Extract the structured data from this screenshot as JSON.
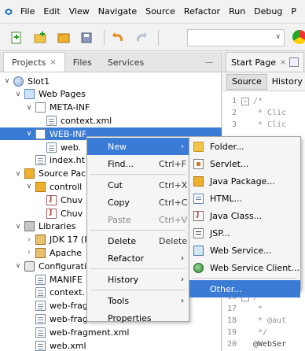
{
  "menubar": {
    "items": [
      "File",
      "Edit",
      "View",
      "Navigate",
      "Source",
      "Refactor",
      "Run",
      "Debug",
      "P"
    ]
  },
  "toolbar": {
    "icons": [
      "new-file-icon",
      "new-project-icon",
      "open-project-icon",
      "save-all-icon",
      "undo-icon",
      "redo-icon"
    ],
    "combo_value": ""
  },
  "projects_panel": {
    "tabs": [
      {
        "label": "Projects",
        "close": "×",
        "active": true
      },
      {
        "label": "Files",
        "active": false
      },
      {
        "label": "Services",
        "active": false
      }
    ],
    "minimize": "—",
    "tree": [
      {
        "label": "Slot1",
        "icon": "globe",
        "indent": 0,
        "chevron": "∨"
      },
      {
        "label": "Web Pages",
        "icon": "webfolder",
        "indent": 1,
        "chevron": "∨"
      },
      {
        "label": "META-INF",
        "icon": "folder-open",
        "indent": 2,
        "chevron": "∨"
      },
      {
        "label": "context.xml",
        "icon": "file",
        "indent": 3,
        "chevron": ""
      },
      {
        "label": "WEB-INF",
        "icon": "folder-open",
        "indent": 2,
        "chevron": "∨",
        "selected": true
      },
      {
        "label": "web.",
        "icon": "file",
        "indent": 3,
        "chevron": ""
      },
      {
        "label": "index.ht",
        "icon": "file",
        "indent": 2,
        "chevron": ""
      },
      {
        "label": "Source Pack",
        "icon": "pkg",
        "indent": 1,
        "chevron": "∨"
      },
      {
        "label": "controll",
        "icon": "pkg",
        "indent": 2,
        "chevron": "∨"
      },
      {
        "label": "Chuv",
        "icon": "java",
        "indent": 3,
        "chevron": ""
      },
      {
        "label": "Chuv",
        "icon": "java",
        "indent": 3,
        "chevron": ""
      },
      {
        "label": "Libraries",
        "icon": "lib",
        "indent": 1,
        "chevron": "∨"
      },
      {
        "label": "JDK 17 (I",
        "icon": "jar",
        "indent": 2,
        "chevron": "›"
      },
      {
        "label": "Apache",
        "icon": "jar",
        "indent": 2,
        "chevron": "›"
      },
      {
        "label": "Configurati",
        "icon": "config",
        "indent": 1,
        "chevron": "∨"
      },
      {
        "label": "MANIFE",
        "icon": "file",
        "indent": 2,
        "chevron": ""
      },
      {
        "label": "context.",
        "icon": "file",
        "indent": 2,
        "chevron": ""
      },
      {
        "label": "web-frag",
        "icon": "file",
        "indent": 2,
        "chevron": ""
      },
      {
        "label": "web-frag",
        "icon": "file",
        "indent": 2,
        "chevron": ""
      },
      {
        "label": "web-fragment.xml",
        "icon": "file",
        "indent": 2,
        "chevron": ""
      },
      {
        "label": "web.xml",
        "icon": "file",
        "indent": 2,
        "chevron": ""
      }
    ]
  },
  "editor": {
    "tab_label": "Start Page",
    "tab_close": "×",
    "subtabs": [
      "Source",
      "History"
    ],
    "top_lines": [
      {
        "n": "1",
        "fold": "−",
        "text": "/*"
      },
      {
        "n": "2",
        "fold": "",
        "text": " * Clic"
      },
      {
        "n": "3",
        "fold": "",
        "text": " * Clic"
      }
    ],
    "bottom_lines": [
      {
        "n": "16",
        "fold": "−",
        "text": "/**"
      },
      {
        "n": "17",
        "fold": "",
        "text": " *"
      },
      {
        "n": "18",
        "fold": "",
        "text": " * @aut"
      },
      {
        "n": "19",
        "fold": "",
        "text": " */"
      },
      {
        "n": "20",
        "fold": "",
        "text": "@WebSer"
      }
    ]
  },
  "context_menu": {
    "items": [
      {
        "label": "New",
        "arrow": "›",
        "highlighted": true
      },
      {
        "label": "Find...",
        "key": "Ctrl+F"
      },
      {
        "sep": true
      },
      {
        "label": "Cut",
        "key": "Ctrl+X"
      },
      {
        "label": "Copy",
        "key": "Ctrl+C"
      },
      {
        "label": "Paste",
        "key": "Ctrl+V",
        "disabled": true
      },
      {
        "sep": true
      },
      {
        "label": "Delete",
        "key": "Delete"
      },
      {
        "label": "Refactor",
        "arrow": "›"
      },
      {
        "sep": true
      },
      {
        "label": "History",
        "arrow": "›"
      },
      {
        "sep": true
      },
      {
        "label": "Tools",
        "arrow": "›"
      },
      {
        "label": "Properties"
      }
    ]
  },
  "new_submenu": {
    "items": [
      {
        "label": "Folder...",
        "icon": "folder"
      },
      {
        "label": "Servlet...",
        "icon": "servlet"
      },
      {
        "label": "Java Package...",
        "icon": "pkg"
      },
      {
        "label": "HTML...",
        "icon": "html"
      },
      {
        "label": "Java Class...",
        "icon": "java"
      },
      {
        "label": "JSP...",
        "icon": "jsp"
      },
      {
        "label": "Web Service...",
        "icon": "ws"
      },
      {
        "label": "Web Service Client...",
        "icon": "wsc"
      },
      {
        "sep": true
      },
      {
        "label": "Other...",
        "icon": "",
        "highlighted": true
      }
    ]
  }
}
